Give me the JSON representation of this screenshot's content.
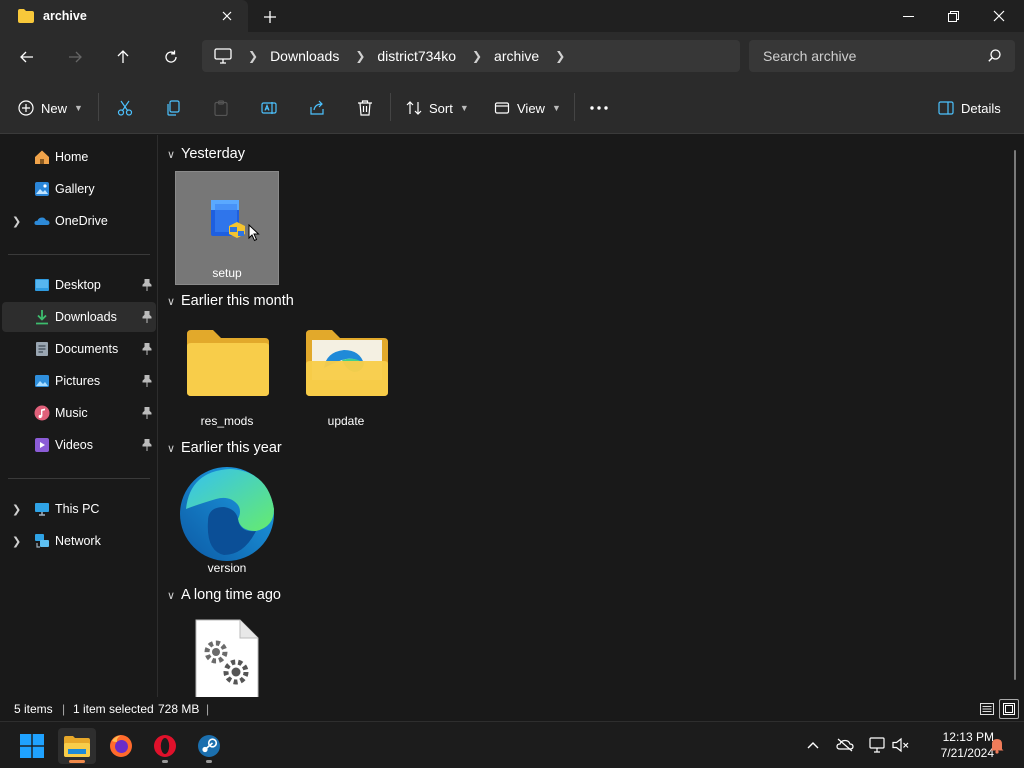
{
  "window": {
    "tab_title": "archive",
    "controls": [
      "minimize",
      "maximize",
      "close"
    ]
  },
  "address": {
    "breadcrumbs": [
      "Downloads",
      "district734ko",
      "archive"
    ],
    "search_placeholder": "Search archive"
  },
  "commandbar": {
    "new_label": "New",
    "sort_label": "Sort",
    "view_label": "View",
    "details_label": "Details"
  },
  "sidebar": {
    "top_items": [
      {
        "label": "Home",
        "icon": "home-icon"
      },
      {
        "label": "Gallery",
        "icon": "gallery-icon"
      },
      {
        "label": "OneDrive",
        "icon": "onedrive-icon"
      }
    ],
    "quick_access": [
      {
        "label": "Desktop",
        "icon": "desktop-icon"
      },
      {
        "label": "Downloads",
        "icon": "downloads-icon",
        "selected": true
      },
      {
        "label": "Documents",
        "icon": "documents-icon"
      },
      {
        "label": "Pictures",
        "icon": "pictures-icon"
      },
      {
        "label": "Music",
        "icon": "music-icon"
      },
      {
        "label": "Videos",
        "icon": "videos-icon"
      }
    ],
    "bottom_items": [
      {
        "label": "This PC",
        "icon": "this-pc-icon"
      },
      {
        "label": "Network",
        "icon": "network-icon"
      }
    ]
  },
  "groups": [
    {
      "title": "Yesterday",
      "items": [
        {
          "name": "setup",
          "icon": "installer-icon",
          "selected": true
        }
      ]
    },
    {
      "title": "Earlier this month",
      "items": [
        {
          "name": "res_mods",
          "icon": "folder-icon"
        },
        {
          "name": "update",
          "icon": "edge-folder-icon"
        }
      ]
    },
    {
      "title": "Earlier this year",
      "items": [
        {
          "name": "version",
          "icon": "edge-icon"
        }
      ]
    },
    {
      "title": "A long time ago",
      "items": [
        {
          "name": "",
          "icon": "config-file-icon"
        }
      ]
    }
  ],
  "status": {
    "item_count": "5 items",
    "selection": "1 item selected",
    "size": "728 MB"
  },
  "taskbar": {
    "apps": [
      "start-icon",
      "file-explorer-icon",
      "firefox-icon",
      "opera-icon",
      "steam-icon"
    ],
    "time": "12:13 PM",
    "date": "7/21/2024"
  },
  "colors": {
    "accent": "#4cc2ff",
    "folder": "#f8c83a",
    "selected_tile": "#777777"
  }
}
